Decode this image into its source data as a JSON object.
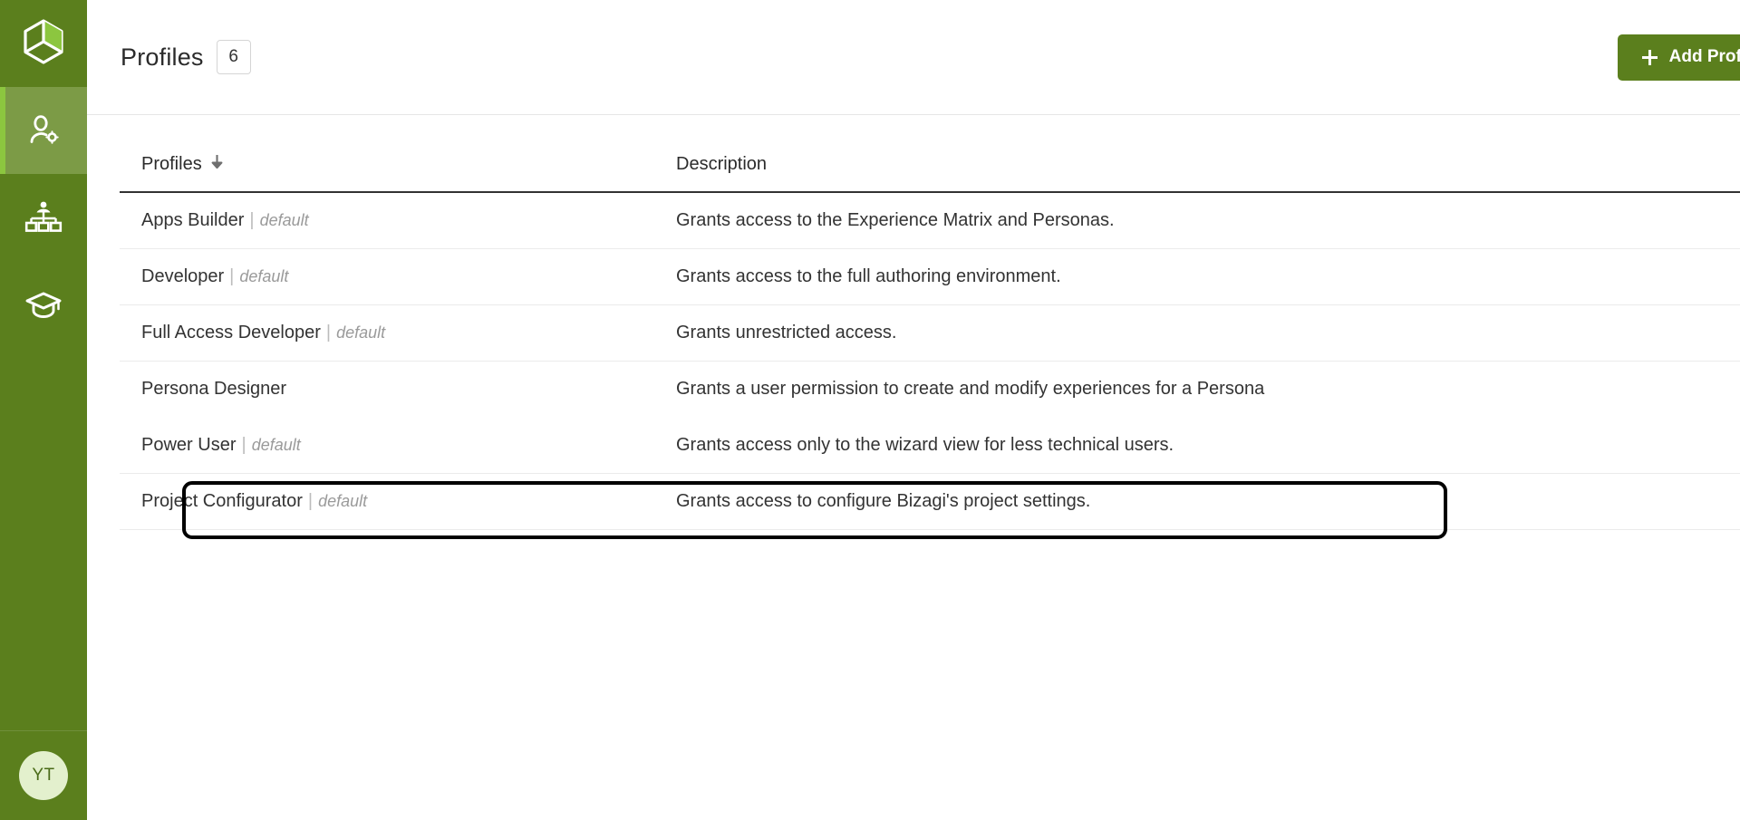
{
  "sidebar": {
    "logo": {
      "name": "bizagi-cube-logo"
    },
    "items": [
      {
        "id": "users-profiles",
        "icon": "user-gear-icon",
        "active": true
      },
      {
        "id": "organization",
        "icon": "org-chart-icon",
        "active": false
      },
      {
        "id": "learning",
        "icon": "graduation-cap-icon",
        "active": false
      }
    ],
    "avatar": {
      "initials": "YT"
    }
  },
  "header": {
    "title": "Profiles",
    "count": "6",
    "add_button": "Add Profile"
  },
  "table": {
    "columns": [
      {
        "key": "name",
        "label": "Profiles",
        "sorted": "asc",
        "sort_icon": "arrow-down-icon"
      },
      {
        "key": "description",
        "label": "Description"
      }
    ],
    "rows": [
      {
        "name": "Apps Builder",
        "tag": "default",
        "description": "Grants access to the Experience Matrix and Personas.",
        "highlighted": false
      },
      {
        "name": "Developer",
        "tag": "default",
        "description": "Grants access to the full authoring environment.",
        "highlighted": false
      },
      {
        "name": "Full Access Developer",
        "tag": "default",
        "description": "Grants unrestricted access.",
        "highlighted": false
      },
      {
        "name": "Persona Designer",
        "tag": "",
        "description": "Grants a user permission to create and modify experiences for a Persona",
        "highlighted": true
      },
      {
        "name": "Power User",
        "tag": "default",
        "description": "Grants access only to the wizard view for less technical users.",
        "highlighted": false
      },
      {
        "name": "Project Configurator",
        "tag": "default",
        "description": "Grants access to configure Bizagi's project settings.",
        "highlighted": false
      }
    ]
  },
  "colors": {
    "sidebar_bg": "#5b7f1d",
    "sidebar_active_bg": "#7c9b46",
    "sidebar_accent": "#8cc63f",
    "brand_green": "#5b7f1d",
    "avatar_bg": "#e3f0cd",
    "avatar_text": "#4a6b18",
    "highlight_border": "#000000",
    "row_divider": "#ebebeb",
    "header_divider": "#333333"
  }
}
